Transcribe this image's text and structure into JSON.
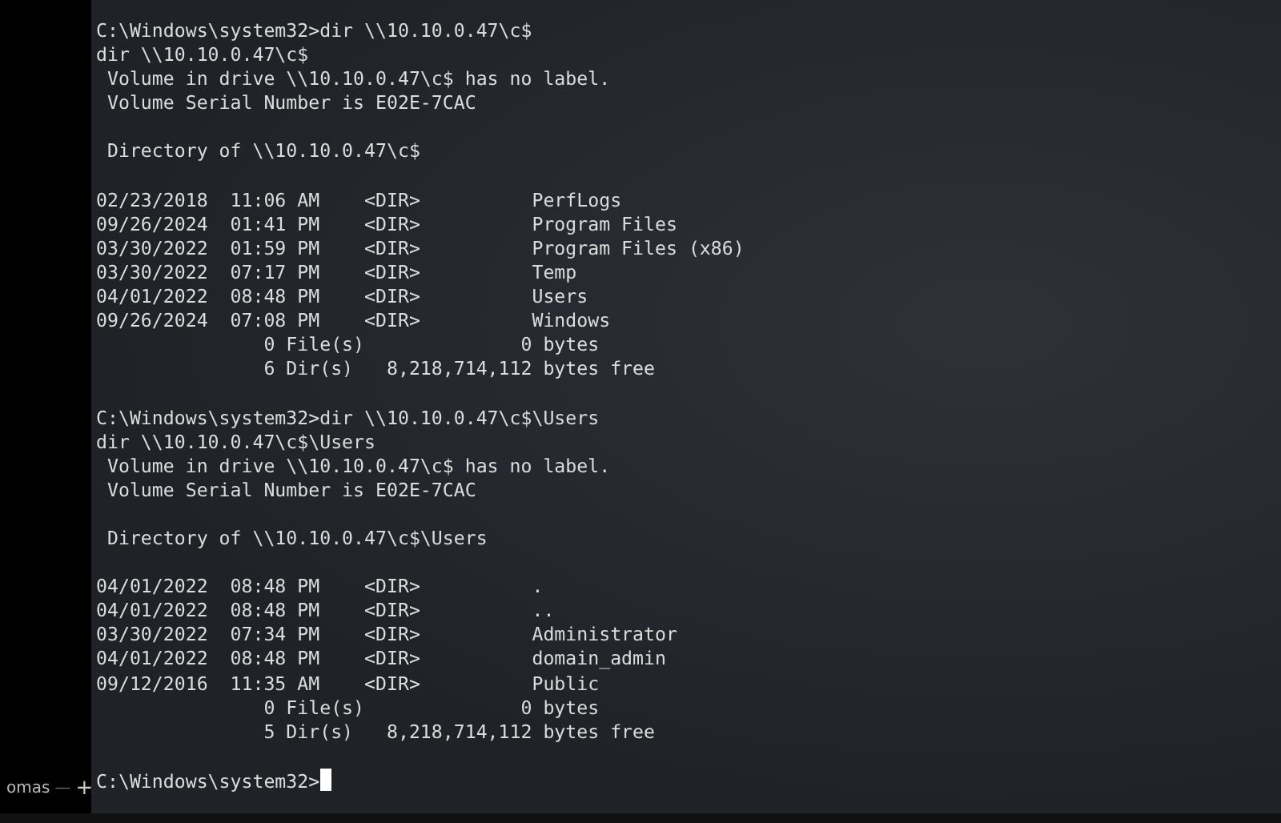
{
  "sidebar": {
    "tab": {
      "label": "omas",
      "close": "—",
      "add": "+"
    }
  },
  "terminal": {
    "lines": [
      {
        "kind": "text",
        "text": "C:\\Windows\\system32>dir \\\\10.10.0.47\\c$"
      },
      {
        "kind": "text",
        "text": "dir \\\\10.10.0.47\\c$"
      },
      {
        "kind": "text",
        "text": " Volume in drive \\\\10.10.0.47\\c$ has no label."
      },
      {
        "kind": "text",
        "text": " Volume Serial Number is E02E-7CAC"
      },
      {
        "kind": "blank"
      },
      {
        "kind": "text",
        "text": " Directory of \\\\10.10.0.47\\c$"
      },
      {
        "kind": "blank"
      },
      {
        "kind": "text",
        "text": "02/23/2018  11:06 AM    <DIR>          PerfLogs"
      },
      {
        "kind": "text",
        "text": "09/26/2024  01:41 PM    <DIR>          Program Files"
      },
      {
        "kind": "text",
        "text": "03/30/2022  01:59 PM    <DIR>          Program Files (x86)"
      },
      {
        "kind": "text",
        "text": "03/30/2022  07:17 PM    <DIR>          Temp"
      },
      {
        "kind": "text",
        "text": "04/01/2022  08:48 PM    <DIR>          Users"
      },
      {
        "kind": "text",
        "text": "09/26/2024  07:08 PM    <DIR>          Windows"
      },
      {
        "kind": "text",
        "text": "               0 File(s)              0 bytes"
      },
      {
        "kind": "text",
        "text": "               6 Dir(s)   8,218,714,112 bytes free"
      },
      {
        "kind": "blank"
      },
      {
        "kind": "text",
        "text": "C:\\Windows\\system32>dir \\\\10.10.0.47\\c$\\Users"
      },
      {
        "kind": "text",
        "text": "dir \\\\10.10.0.47\\c$\\Users"
      },
      {
        "kind": "text",
        "text": " Volume in drive \\\\10.10.0.47\\c$ has no label."
      },
      {
        "kind": "text",
        "text": " Volume Serial Number is E02E-7CAC"
      },
      {
        "kind": "blank"
      },
      {
        "kind": "text",
        "text": " Directory of \\\\10.10.0.47\\c$\\Users"
      },
      {
        "kind": "blank"
      },
      {
        "kind": "text",
        "text": "04/01/2022  08:48 PM    <DIR>          ."
      },
      {
        "kind": "text",
        "text": "04/01/2022  08:48 PM    <DIR>          .."
      },
      {
        "kind": "text",
        "text": "03/30/2022  07:34 PM    <DIR>          Administrator"
      },
      {
        "kind": "text",
        "text": "04/01/2022  08:48 PM    <DIR>          domain_admin"
      },
      {
        "kind": "text",
        "text": "09/12/2016  11:35 AM    <DIR>          Public"
      },
      {
        "kind": "text",
        "text": "               0 File(s)              0 bytes"
      },
      {
        "kind": "text",
        "text": "               5 Dir(s)   8,218,714,112 bytes free"
      },
      {
        "kind": "blank"
      },
      {
        "kind": "prompt",
        "text": "C:\\Windows\\system32>",
        "cursor": true
      }
    ]
  }
}
